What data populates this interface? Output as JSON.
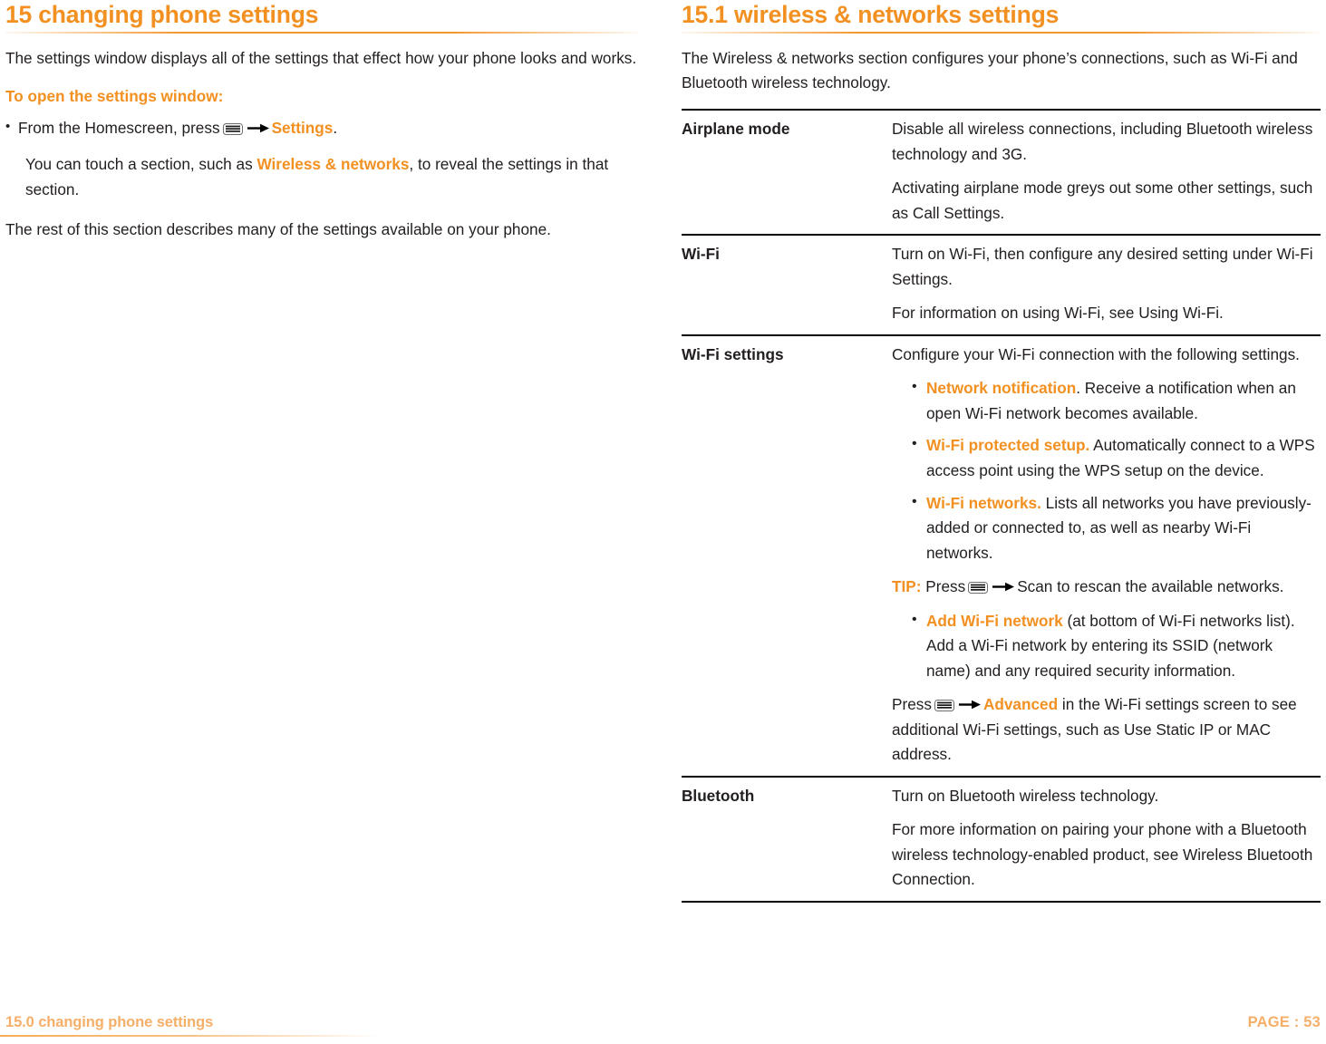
{
  "left": {
    "title": "15 changing phone settings",
    "intro": "The settings window displays all of the settings that effect how your phone looks and works.",
    "subhead": "To open the settings window:",
    "bullet_prefix": "From the Homescreen, press",
    "bullet_link": "Settings",
    "bullet_suffix": ".",
    "indented_prefix": "You can touch a section, such as ",
    "indented_link": "Wireless & networks",
    "indented_suffix": ", to reveal the settings in that section.",
    "closing": "The rest of this section describes many of the settings available on your phone."
  },
  "right": {
    "title": "15.1 wireless & networks settings",
    "intro": "The Wireless & networks section configures your phone’s connections, such as Wi-Fi and Bluetooth wireless technology.",
    "table": {
      "rows": [
        {
          "term": "Airplane mode",
          "paragraphs": [
            "Disable all wireless connections, including Bluetooth wireless technology and 3G.",
            "Activating airplane mode greys out some other settings, such as Call Settings."
          ]
        },
        {
          "term": "Wi-Fi",
          "paragraphs": [
            "Turn on Wi-Fi, then configure any desired setting under Wi-Fi Settings.",
            "For information on using Wi-Fi, see Using Wi-Fi."
          ]
        },
        {
          "term": "Wi-Fi settings",
          "lead": "Configure your Wi-Fi connection with the following settings.",
          "bullets_group_1": [
            {
              "link": "Network notification",
              "rest": ". Receive a notification when an open Wi-Fi network becomes available."
            },
            {
              "link": "Wi-Fi protected setup.",
              "rest": " Automatically connect to a WPS access point using the WPS setup on the device."
            },
            {
              "link": "Wi-Fi networks.",
              "rest": " Lists all networks you have previously-added or connected to, as well as nearby Wi-Fi networks."
            }
          ],
          "tip_label": "TIP:",
          "tip_prefix": "Press",
          "tip_suffix": "Scan to rescan the available networks.",
          "bullets_group_2": [
            {
              "link": "Add Wi-Fi network",
              "rest": " (at bottom of Wi-Fi networks list). Add a Wi-Fi network by entering its SSID (network name) and any required security information."
            }
          ],
          "advanced_prefix": "Press",
          "advanced_link": "Advanced",
          "advanced_suffix": "in the Wi-Fi settings screen to see additional Wi-Fi settings, such as Use Static IP or MAC address."
        },
        {
          "term": "Bluetooth",
          "paragraphs": [
            "Turn on Bluetooth wireless technology.",
            "For more information on pairing your phone with a Bluetooth wireless technology-enabled product, see Wireless Bluetooth Connection."
          ]
        }
      ]
    }
  },
  "footer": {
    "left": "15.0 changing phone settings",
    "right": "PAGE : 53"
  },
  "colors": {
    "accent": "#F29021",
    "footer_accent": "#F6AF69",
    "text": "#221e1f"
  },
  "icons": {
    "menu_key": "menu-key-icon",
    "arrow": "right-arrow-icon"
  }
}
